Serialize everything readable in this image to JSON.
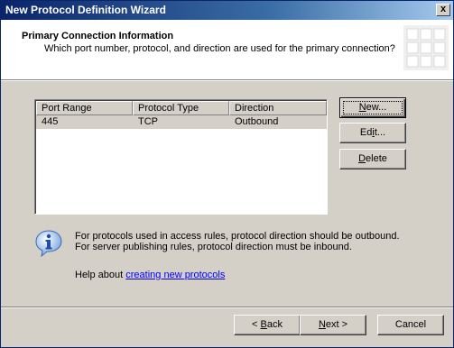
{
  "window": {
    "title": "New Protocol Definition Wizard",
    "close_label": "x"
  },
  "header": {
    "title": "Primary Connection Information",
    "subtitle": "Which port number, protocol, and direction are used for the primary connection?"
  },
  "table": {
    "columns": [
      "Port Range",
      "Protocol Type",
      "Direction"
    ],
    "rows": [
      {
        "port_range": "445",
        "protocol_type": "TCP",
        "direction": "Outbound"
      }
    ]
  },
  "side_buttons": {
    "new": {
      "before": "",
      "mnemonic": "N",
      "after": "ew..."
    },
    "edit": {
      "before": "Ed",
      "mnemonic": "i",
      "after": "t..."
    },
    "delete": {
      "before": "",
      "mnemonic": "D",
      "after": "elete"
    }
  },
  "info": {
    "line1": "For protocols used in access rules, protocol direction should be outbound.",
    "line2": "For server publishing rules, protocol direction must be inbound.",
    "help_prefix": "Help about ",
    "help_link": "creating new protocols"
  },
  "footer": {
    "back": {
      "prefix": "< ",
      "mnemonic": "B",
      "after": "ack"
    },
    "next": {
      "before": "",
      "mnemonic": "N",
      "after": "ext >"
    },
    "cancel": "Cancel"
  }
}
